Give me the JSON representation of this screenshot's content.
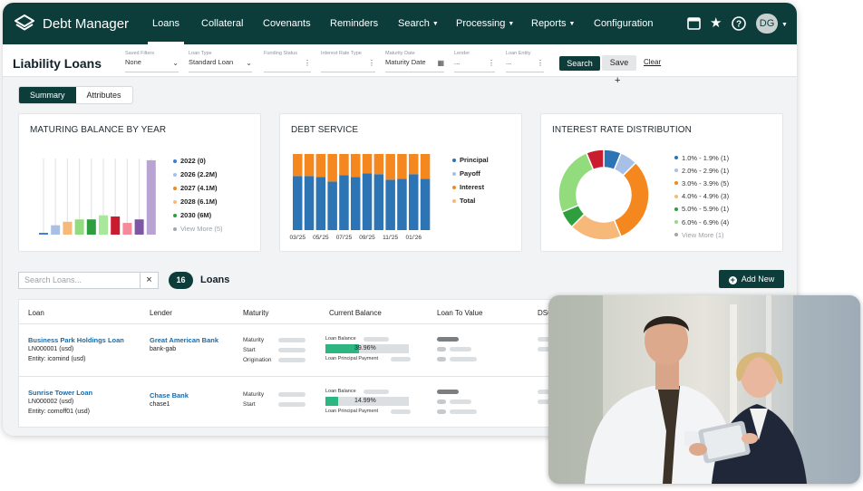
{
  "app": {
    "title": "Debt Manager",
    "user_initials": "DG"
  },
  "nav": {
    "items": [
      {
        "label": "Loans",
        "active": true
      },
      {
        "label": "Collateral"
      },
      {
        "label": "Covenants"
      },
      {
        "label": "Reminders"
      },
      {
        "label": "Search",
        "dropdown": true
      },
      {
        "label": "Processing",
        "dropdown": true
      },
      {
        "label": "Reports",
        "dropdown": true
      },
      {
        "label": "Configuration"
      }
    ],
    "icons": [
      "calculator-icon",
      "star-icon",
      "help-icon"
    ]
  },
  "page": {
    "title": "Liability Loans"
  },
  "filters": [
    {
      "label": "Saved Filters",
      "value": "None"
    },
    {
      "label": "Loan Type",
      "value": "Standard Loan"
    },
    {
      "label": "Funding Status",
      "value": ""
    },
    {
      "label": "Interest Rate Type",
      "value": ""
    },
    {
      "label": "Maturity Date",
      "value": "Maturity Date"
    },
    {
      "label": "Lender",
      "value": "..."
    },
    {
      "label": "Loan Entity",
      "value": "..."
    }
  ],
  "actions": {
    "search": "Search",
    "save": "Save",
    "clear": "Clear"
  },
  "tabs": [
    {
      "label": "Summary",
      "active": true
    },
    {
      "label": "Attributes"
    }
  ],
  "cards": {
    "maturing": {
      "title": "MATURING BALANCE BY YEAR",
      "legend": [
        {
          "label": "2022 (0)",
          "color": "#3b7dd8"
        },
        {
          "label": "2026 (2.2M)",
          "color": "#a8bfe6"
        },
        {
          "label": "2027 (4.1M)",
          "color": "#f5871f"
        },
        {
          "label": "2028 (6.1M)",
          "color": "#f7b97a"
        },
        {
          "label": "2030 (6M)",
          "color": "#2e9e3e"
        },
        {
          "label": "View More (5)",
          "color": "#a0a6ab",
          "muted": true
        }
      ]
    },
    "debt": {
      "title": "DEBT SERVICE",
      "legend": [
        {
          "label": "Principal",
          "color": "#2c74b3"
        },
        {
          "label": "Payoff",
          "color": "#a8bfe6"
        },
        {
          "label": "Interest",
          "color": "#f5871f"
        },
        {
          "label": "Total",
          "color": "#f7b97a"
        }
      ]
    },
    "rate": {
      "title": "INTEREST RATE DISTRIBUTION",
      "legend": [
        {
          "label": "1.0% - 1.9% (1)",
          "color": "#2c74b3"
        },
        {
          "label": "2.0% - 2.9% (1)",
          "color": "#a8bfe6"
        },
        {
          "label": "3.0% - 3.9% (5)",
          "color": "#f5871f"
        },
        {
          "label": "4.0% - 4.9% (3)",
          "color": "#f7b97a"
        },
        {
          "label": "5.0% - 5.9% (1)",
          "color": "#2e9e3e"
        },
        {
          "label": "6.0% - 6.9% (4)",
          "color": "#93dc7e"
        },
        {
          "label": "View More (1)",
          "color": "#a0a6ab",
          "muted": true
        }
      ]
    }
  },
  "chart_data": [
    {
      "type": "bar",
      "title": "MATURING BALANCE BY YEAR",
      "values": [
        0.3,
        1.6,
        2.2,
        2.6,
        2.6,
        3.3,
        3.1,
        2.0,
        2.6,
        12.7
      ],
      "colors": [
        "#3b7dd8",
        "#a8bfe6",
        "#f7b97a",
        "#93dc7e",
        "#2e9e3e",
        "#a8e89a",
        "#c91c2e",
        "#f48a9a",
        "#7d57a6",
        "#b9a3d2"
      ],
      "ylim": [
        0,
        13
      ]
    },
    {
      "type": "bar",
      "title": "DEBT SERVICE",
      "stacked": true,
      "categories": [
        "03/'25",
        "",
        "05/'25",
        "",
        "07/'25",
        "",
        "09/'25",
        "",
        "11/'25",
        "",
        "01/'26",
        ""
      ],
      "series": [
        {
          "name": "Principal",
          "values": [
            59,
            59,
            58,
            53,
            60,
            58,
            62,
            61,
            55,
            56,
            61,
            56
          ],
          "color": "#2c74b3"
        },
        {
          "name": "Interest",
          "values": [
            24,
            24,
            25,
            30,
            23,
            25,
            21,
            22,
            28,
            27,
            22,
            27
          ],
          "color": "#f5871f"
        }
      ],
      "ylim": [
        0,
        83
      ]
    },
    {
      "type": "pie",
      "title": "INTEREST RATE DISTRIBUTION",
      "donut": true,
      "values": [
        1,
        1,
        5,
        3,
        1,
        4,
        1
      ],
      "colors": [
        "#2c74b3",
        "#a8bfe6",
        "#f5871f",
        "#f7b97a",
        "#2e9e3e",
        "#93dc7e",
        "#c91c2e"
      ]
    }
  ],
  "list": {
    "search_placeholder": "Search Loans...",
    "count": "16",
    "label": "Loans",
    "add_label": "Add New",
    "columns": [
      "Loan",
      "Lender",
      "Maturity",
      "Current Balance",
      "Loan To Value",
      "DSC"
    ],
    "rows": [
      {
        "name": "Business Park Holdings Loan",
        "id": "LN000001 (usd)",
        "entity": "Entity: icomind (usd)",
        "lender": "Great American Bank",
        "lender_code": "bank-gab",
        "maturity": [
          "Maturity",
          "Start",
          "Origination"
        ],
        "balance_label": "Loan Balance",
        "balance_pct": "39.96%",
        "balance_fill": 0.3996,
        "payment_label": "Loan Principal Payment"
      },
      {
        "name": "Sunrise Tower Loan",
        "id": "LN000002 (usd)",
        "entity": "Entity: comoff01 (usd)",
        "lender": "Chase Bank",
        "lender_code": "chase1",
        "maturity": [
          "Maturity",
          "Start"
        ],
        "balance_label": "Loan Balance",
        "balance_pct": "14.99%",
        "balance_fill": 0.1499,
        "payment_label": "Loan Principal Payment"
      }
    ]
  }
}
